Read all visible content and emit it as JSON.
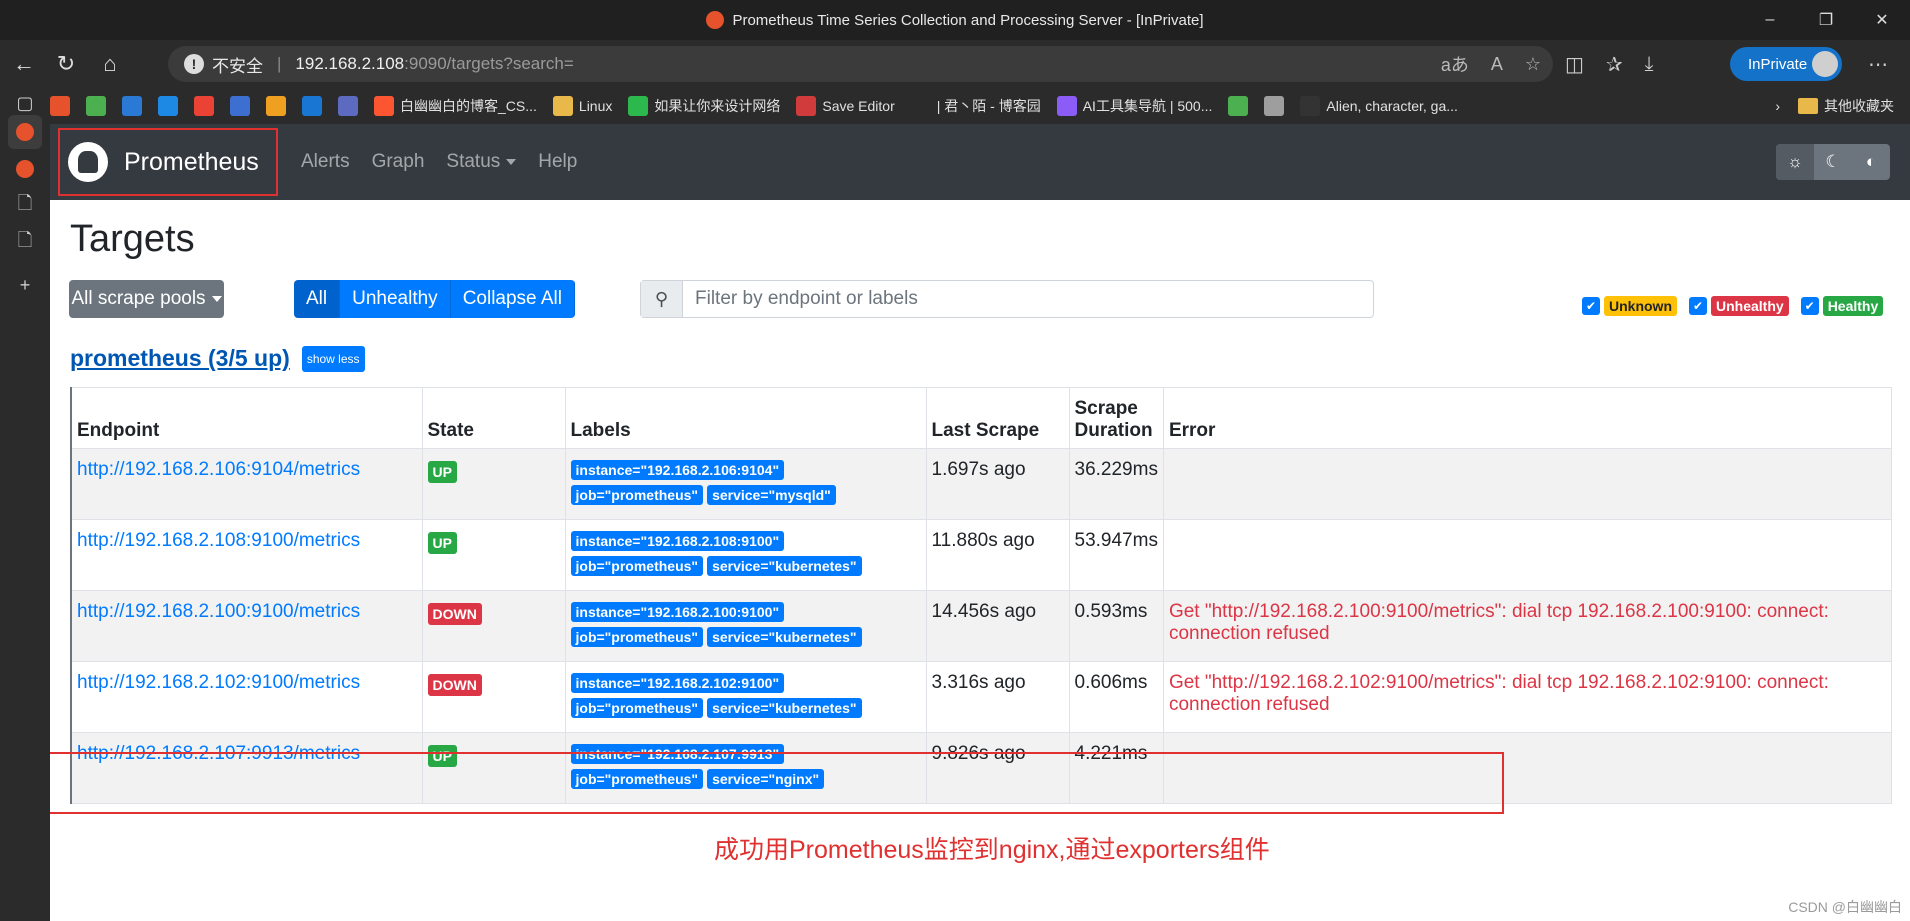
{
  "window": {
    "title": "Prometheus Time Series Collection and Processing Server - [InPrivate]",
    "controls": [
      "–",
      "❐",
      "✕"
    ]
  },
  "address_bar": {
    "security": "不安全",
    "host": "192.168.2.108",
    "path": ":9090/targets?search=",
    "inprivate": "InPrivate"
  },
  "bookmarks": {
    "items": [
      {
        "label": "",
        "color": "#e6522c"
      },
      {
        "label": "",
        "color": "#4caf50"
      },
      {
        "label": "",
        "color": "#2a7ad5"
      },
      {
        "label": "",
        "color": "#1e88e5"
      },
      {
        "label": "",
        "color": "#ea4335"
      },
      {
        "label": "",
        "color": "#3d6fd1"
      },
      {
        "label": "",
        "color": "#f0a020"
      },
      {
        "label": "",
        "color": "#1976d2"
      },
      {
        "label": "",
        "color": "#5c6bc0"
      },
      {
        "label": "白幽幽白的博客_CS...",
        "color": "#fc5531"
      },
      {
        "label": "Linux",
        "color": "#e8b84a"
      },
      {
        "label": "如果让你来设计网络",
        "color": "#2db84d"
      },
      {
        "label": "Save Editor",
        "color": "#d23b3b"
      },
      {
        "label": "| 君丶陌 - 博客园",
        "color": "#2b2b2b"
      },
      {
        "label": "AI工具集导航 | 500...",
        "color": "#8b5cf6"
      },
      {
        "label": "",
        "color": "#4caf50"
      },
      {
        "label": "",
        "color": "#9e9e9e"
      },
      {
        "label": "Alien, character, ga...",
        "color": "#333333"
      }
    ],
    "other": "其他收藏夹"
  },
  "prometheus": {
    "brand": "Prometheus",
    "nav": {
      "alerts": "Alerts",
      "graph": "Graph",
      "status": "Status",
      "help": "Help"
    },
    "page_title": "Targets",
    "pools_button": "All scrape pools",
    "filter_buttons": {
      "all": "All",
      "unhealthy": "Unhealthy",
      "collapse": "Collapse All"
    },
    "search_placeholder": "Filter by endpoint or labels",
    "state_filters": {
      "unknown": "Unknown",
      "unhealthy": "Unhealthy",
      "healthy": "Healthy"
    },
    "pool": {
      "title": "prometheus (3/5 up)",
      "toggle": "show less"
    },
    "table": {
      "headers": {
        "endpoint": "Endpoint",
        "state": "State",
        "labels": "Labels",
        "last_scrape": "Last Scrape",
        "duration": "Scrape Duration",
        "error": "Error"
      },
      "rows": [
        {
          "endpoint": "http://192.168.2.106:9104/metrics",
          "state": "UP",
          "labels": [
            "instance=\"192.168.2.106:9104\"",
            "job=\"prometheus\"",
            "service=\"mysqld\""
          ],
          "last_scrape": "1.697s ago",
          "duration": "36.229ms",
          "error": ""
        },
        {
          "endpoint": "http://192.168.2.108:9100/metrics",
          "state": "UP",
          "labels": [
            "instance=\"192.168.2.108:9100\"",
            "job=\"prometheus\"",
            "service=\"kubernetes\""
          ],
          "last_scrape": "11.880s ago",
          "duration": "53.947ms",
          "error": ""
        },
        {
          "endpoint": "http://192.168.2.100:9100/metrics",
          "state": "DOWN",
          "labels": [
            "instance=\"192.168.2.100:9100\"",
            "job=\"prometheus\"",
            "service=\"kubernetes\""
          ],
          "last_scrape": "14.456s ago",
          "duration": "0.593ms",
          "error": "Get \"http://192.168.2.100:9100/metrics\": dial tcp 192.168.2.100:9100: connect: connection refused"
        },
        {
          "endpoint": "http://192.168.2.102:9100/metrics",
          "state": "DOWN",
          "labels": [
            "instance=\"192.168.2.102:9100\"",
            "job=\"prometheus\"",
            "service=\"kubernetes\""
          ],
          "last_scrape": "3.316s ago",
          "duration": "0.606ms",
          "error": "Get \"http://192.168.2.102:9100/metrics\": dial tcp 192.168.2.102:9100: connect: connection refused"
        },
        {
          "endpoint": "http://192.168.2.107:9913/metrics",
          "state": "UP",
          "labels": [
            "instance=\"192.168.2.107:9913\"",
            "job=\"prometheus\"",
            "service=\"nginx\""
          ],
          "last_scrape": "9.826s ago",
          "duration": "4.221ms",
          "error": ""
        }
      ]
    }
  },
  "annotation": "成功用Prometheus监控到nginx,通过exporters组件",
  "watermark": "CSDN @白幽幽白"
}
